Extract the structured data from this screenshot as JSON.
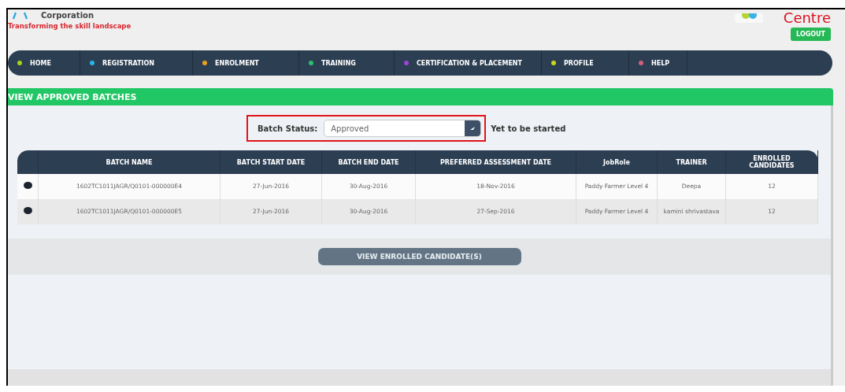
{
  "header": {
    "org": "Corporation",
    "tagline": "Transforming the skill landscape",
    "brand": "Centre",
    "logout": "LOGOUT"
  },
  "nav": [
    {
      "label": "HOME",
      "color": "#a6d11c"
    },
    {
      "label": "REGISTRATION",
      "color": "#29b6e6"
    },
    {
      "label": "ENROLMENT",
      "color": "#e8a020"
    },
    {
      "label": "TRAINING",
      "color": "#2bbf6a"
    },
    {
      "label": "CERTIFICATION & PLACEMENT",
      "color": "#9b45d6"
    },
    {
      "label": "PROFILE",
      "color": "#c8d81a"
    },
    {
      "label": "HELP",
      "color": "#d0607a"
    }
  ],
  "section_title": "VIEW APPROVED BATCHES",
  "filter": {
    "label": "Batch Status:",
    "value": "Approved",
    "note": "Yet to be started"
  },
  "table": {
    "columns": [
      "BATCH NAME",
      "BATCH START DATE",
      "BATCH END DATE",
      "PREFERRED ASSESSMENT DATE",
      "JobRole",
      "TRAINER",
      "ENROLLED CANDIDATES"
    ],
    "rows": [
      {
        "selected": false,
        "cells": [
          "1602TC1011JAGR/Q0101-000000E4",
          "27-Jun-2016",
          "30-Aug-2016",
          "18-Nov-2016",
          "Paddy Farmer Level 4",
          "Deepa",
          "12"
        ]
      },
      {
        "selected": false,
        "cells": [
          "1602TC1011JAGR/Q0101-000000E5",
          "27-Jun-2016",
          "30-Aug-2016",
          "27-Sep-2016",
          "Paddy Farmer Level 4",
          "kamini shrivastava",
          "12"
        ]
      }
    ]
  },
  "action_button": "VIEW ENROLLED CANDIDATE(S)"
}
